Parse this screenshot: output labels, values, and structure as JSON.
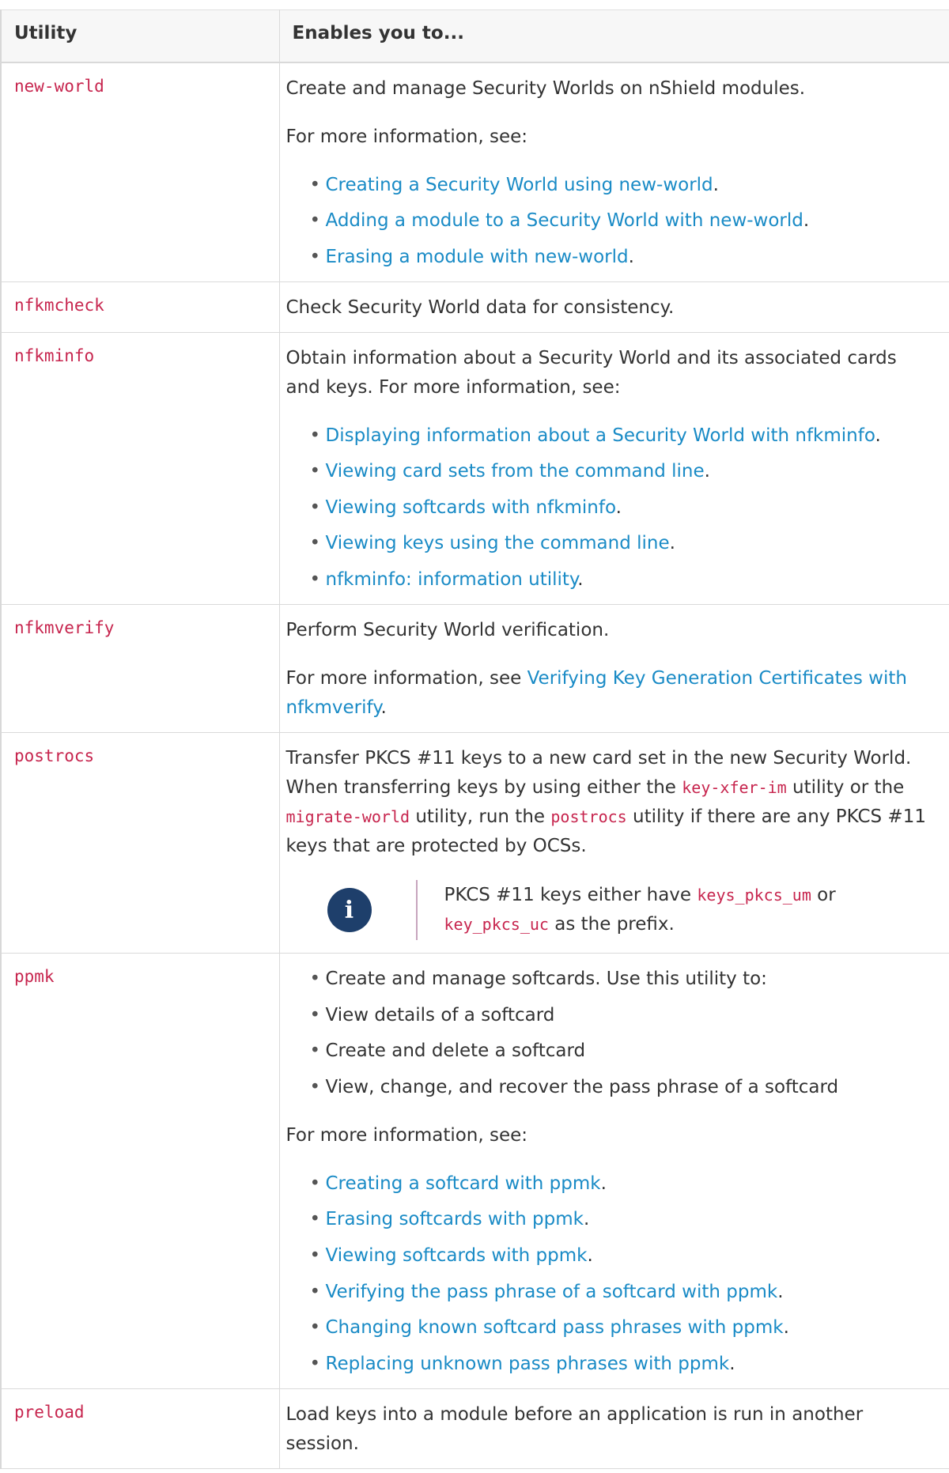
{
  "table": {
    "headers": {
      "utility": "Utility",
      "enables": "Enables you to..."
    },
    "rows": {
      "new_world": {
        "name": "new-world",
        "desc": "Create and manage Security Worlds on nShield modules.",
        "more": "For more information, see:",
        "links": [
          "Creating a Security World using new-world",
          "Adding a module to a Security World with new-world",
          "Erasing a module with new-world"
        ]
      },
      "nfkmcheck": {
        "name": "nfkmcheck",
        "desc": "Check Security World data for consistency."
      },
      "nfkminfo": {
        "name": "nfkminfo",
        "desc": "Obtain information about a Security World and its associated cards and keys. For more information, see:",
        "links": [
          "Displaying information about a Security World with nfkminfo",
          "Viewing card sets from the command line",
          "Viewing softcards with nfkminfo",
          "Viewing keys using the command line",
          "nfkminfo: information utility"
        ]
      },
      "nfkmverify": {
        "name": "nfkmverify",
        "desc": "Perform Security World verification.",
        "more_prefix": "For more information, see ",
        "more_link": "Verifying Key Generation Certificates with nfkmverify",
        "more_suffix": "."
      },
      "postrocs": {
        "name": "postrocs",
        "desc_1": "Transfer PKCS #11 keys to a new card set in the new Security World. When transferring keys by using either the ",
        "code_1": "key-xfer-im",
        "desc_2": " utility or the ",
        "code_2": "migrate-world",
        "desc_3": " utility, run the ",
        "code_3": "postrocs",
        "desc_4": " utility if there are any PKCS #11 keys that are protected by OCSs.",
        "note": {
          "icon": "info-icon",
          "icon_glyph": "i",
          "text_1": "PKCS #11 keys either have ",
          "code_1": "keys_pkcs_um",
          "text_2": " or ",
          "code_2": "key_pkcs_uc",
          "text_3": " as the prefix."
        }
      },
      "ppmk": {
        "name": "ppmk",
        "bullets": [
          "Create and manage softcards. Use this utility to:",
          "View details of a softcard",
          "Create and delete a softcard",
          "View, change, and recover the pass phrase of a softcard"
        ],
        "more": "For more information, see:",
        "links": [
          "Creating a softcard with ppmk",
          "Erasing softcards with ppmk",
          "Viewing softcards with ppmk",
          "Verifying the pass phrase of a softcard with ppmk",
          "Changing known softcard pass phrases with ppmk",
          "Replacing unknown pass phrases with ppmk"
        ]
      },
      "preload": {
        "name": "preload",
        "desc": "Load keys into a module before an application is run in another session."
      }
    }
  },
  "bullet_glyph": "•",
  "colors": {
    "code": "#c7254e",
    "link": "#1a8bc6",
    "header_bg": "#f7f7f7",
    "note_icon_bg": "#1e3f6b",
    "note_bar": "#c7a5be",
    "text": "#333333"
  }
}
